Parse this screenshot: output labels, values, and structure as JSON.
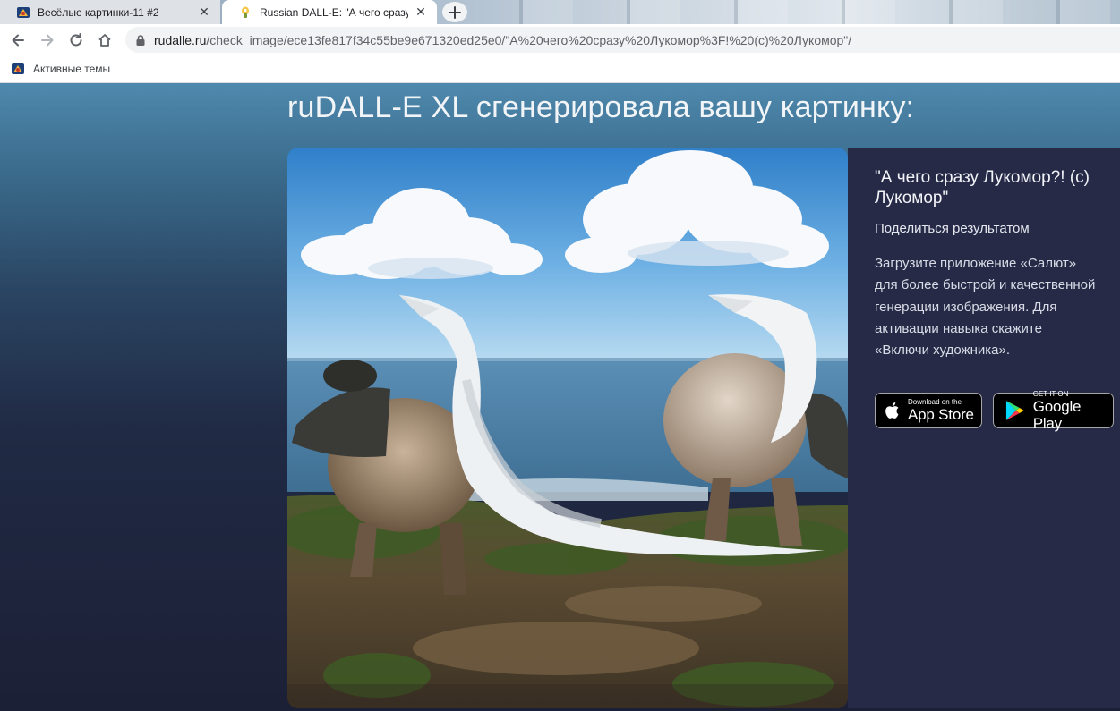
{
  "browser": {
    "tabs": [
      {
        "title": "Весёлые картинки-11 #2",
        "active": false
      },
      {
        "title": "Russian DALL-E: \"А чего сразу Лукомор?! (с) Лукомор\"",
        "active": true
      }
    ],
    "address": {
      "host": "rudalle.ru",
      "path": "/check_image/ece13fe817f34c55be9e671320ed25e0/\"А%20чего%20сразу%20Лукомор%3F!%20(с)%20Лукомор\"/"
    },
    "bookmarks": [
      {
        "label": "Активные темы"
      }
    ]
  },
  "page": {
    "heading": "ruDALL-E XL сгенерировала вашу картинку:",
    "prompt": "\"А чего сразу Лукомор?! (с) Лукомор\"",
    "share_label": "Поделиться результатом",
    "promo_text": "Загрузите приложение «Салют» для более быстрой и качественной генерации изображения. Для активации навыка скажите «Включи художника».",
    "app_store": {
      "small": "Download on the",
      "big": "App Store"
    },
    "google_play": {
      "small": "GET IT ON",
      "big": "Google Play"
    }
  },
  "colors": {
    "accent_panel": "#262a47",
    "page_top": "#4e89ad",
    "page_bottom": "#1c2036"
  }
}
